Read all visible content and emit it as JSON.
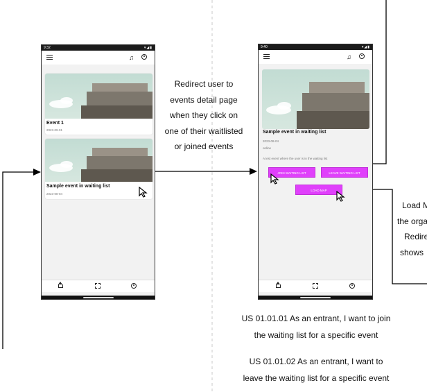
{
  "left_phone": {
    "status_time": "9:32",
    "status_right": "▾◢▮",
    "cards": [
      {
        "title": "Event 1",
        "date": "2023-09-01"
      },
      {
        "title": "Sample event in waiting list",
        "date": "2023-08-04"
      }
    ]
  },
  "right_phone": {
    "status_time": "9:40",
    "status_right": "▾◢▮",
    "event": {
      "title": "Sample event in waiting list",
      "date": "2023-08-04",
      "location": "online",
      "description": "A test event where the user is in the waiting list"
    },
    "buttons": {
      "join": "JOIN WAITING LIST",
      "leave": "LEAVE WAITING LIST",
      "map": "LOAD MAP"
    }
  },
  "annotation_redirect": [
    "Redirect user to",
    "events detail page",
    "when they click on",
    "one of their waitlisted",
    "or joined events"
  ],
  "annotation_map_partial": [
    "Load M",
    "the orga",
    "Redire",
    "shows"
  ],
  "user_stories": [
    [
      "US 01.01.01 As an entrant, I want to join",
      "the waiting list for a specific event"
    ],
    [
      "US 01.01.02 As an entrant, I want to",
      "leave the waiting list for a specific event"
    ]
  ],
  "icons": [
    "menu-icon",
    "bell-icon",
    "account-icon",
    "home-icon",
    "scan-icon",
    "profile-icon",
    "cursor-icon"
  ],
  "colors": {
    "button": "#e040fb",
    "photo_sky": "#c8dfd6",
    "building": "#6f695f"
  }
}
